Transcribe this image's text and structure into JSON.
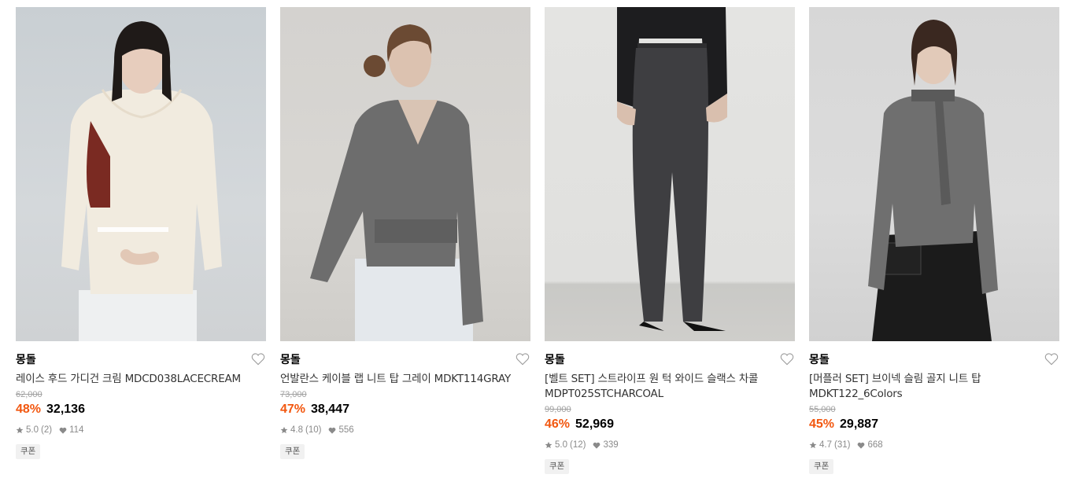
{
  "products": [
    {
      "brand": "몽돌",
      "name": "레이스 후드 가디건 크림 MDCD038LACECREAM",
      "original_price": "62,000",
      "discount": "48%",
      "price": "32,136",
      "rating": "5.0",
      "review_count": "(2)",
      "likes": "114",
      "coupon": "쿠폰",
      "photo_tone": "#cfd4d7"
    },
    {
      "brand": "몽돌",
      "name": "언발란스 케이블 랩 니트 탑 그레이 MDKT114GRAY",
      "original_price": "73,000",
      "discount": "47%",
      "price": "38,447",
      "rating": "4.8",
      "review_count": "(10)",
      "likes": "556",
      "coupon": "쿠폰",
      "photo_tone": "#d5d3cf"
    },
    {
      "brand": "몽돌",
      "name": "[벨트 SET] 스트라이프 원 턱 와이드 슬랙스 차콜 MDPT025STCHARCOAL",
      "original_price": "99,000",
      "discount": "46%",
      "price": "52,969",
      "rating": "5.0",
      "review_count": "(12)",
      "likes": "339",
      "coupon": "쿠폰",
      "photo_tone": "#e2e2e0"
    },
    {
      "brand": "몽돌",
      "name": "[머플러 SET] 브이넥 슬림 골지 니트 탑 MDKT122_6Colors",
      "original_price": "55,000",
      "discount": "45%",
      "price": "29,887",
      "rating": "4.7",
      "review_count": "(31)",
      "likes": "668",
      "coupon": "쿠폰",
      "photo_tone": "#d8d8d8"
    }
  ],
  "colors": {
    "discount": "#f2570f",
    "text": "#000000",
    "muted": "#8a8a8a"
  },
  "icons": {
    "like": "heart-outline-icon",
    "rating": "star-icon",
    "likes_count": "heart-filled-icon"
  }
}
